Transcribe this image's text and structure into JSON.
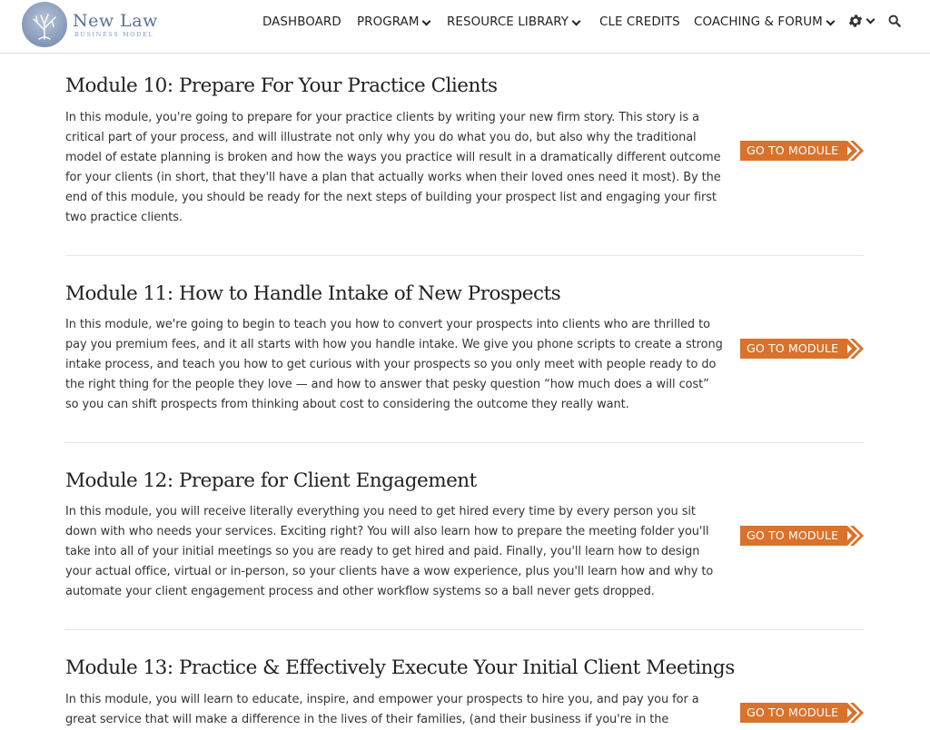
{
  "brand": {
    "name": "New Law",
    "tagline": "BUSINESS MODEL"
  },
  "nav": [
    {
      "label": "DASHBOARD",
      "dropdown": false
    },
    {
      "label": "PROGRAM",
      "dropdown": true
    },
    {
      "label": "RESOURCE LIBRARY",
      "dropdown": true
    },
    {
      "label": "CLE CREDITS",
      "dropdown": false
    },
    {
      "label": "COACHING & FORUM",
      "dropdown": true
    }
  ],
  "icons": {
    "settings": "gear-icon",
    "search": "search-icon"
  },
  "colors": {
    "accent": "#d9722c",
    "logo": "#5b6f95",
    "text": "#333333",
    "divider": "#e6e6e6"
  },
  "modules": [
    {
      "title": "Module 10: Prepare For Your Practice Clients",
      "description": "In this module, you're going to prepare for your practice clients by writing your new firm story. This story is a critical part of your process, and will illustrate not only why you do what you do, but also why the traditional model of estate planning is broken and how the ways you practice will result in a dramatically different outcome for your clients (in short, that they'll have a plan that actually works when their loved ones need it most). By the end of this module, you should be ready for the next steps of building your prospect list and engaging your first two practice clients.",
      "button": "GO TO MODULE"
    },
    {
      "title": "Module 11: How to Handle Intake of New Prospects",
      "description": "In this module, we're going to begin to teach you how to convert your prospects into clients who are thrilled to pay you premium fees, and it all starts with how you handle intake. We give you phone scripts to create a strong intake process, and teach you how to get curious with your prospects so you only meet with people ready to do the right thing for the people they love — and how to answer that pesky question “how much does a will cost” so you can shift prospects from thinking about cost to considering the outcome they really want.",
      "button": "GO TO MODULE"
    },
    {
      "title": "Module 12: Prepare for Client Engagement",
      "description": "In this module, you will receive literally everything you need to get hired every time by every person you sit down with who needs your services. Exciting right? You will also learn how to prepare the meeting folder you'll take into all of your initial meetings so you are ready to get hired and paid. Finally, you'll learn how to design your actual office, virtual or in-person, so your clients have a wow experience, plus you'll learn how and why to automate your client engagement process and other workflow systems so a ball never gets dropped.",
      "button": "GO TO MODULE"
    },
    {
      "title": "Module 13: Practice & Effectively Execute Your Initial Client Meetings",
      "description": "In this module, you will learn to educate, inspire, and empower your prospects to hire you, and pay you for a great service that will make a difference in the lives of their families, (and their business if you're in the",
      "button": "GO TO MODULE"
    }
  ]
}
